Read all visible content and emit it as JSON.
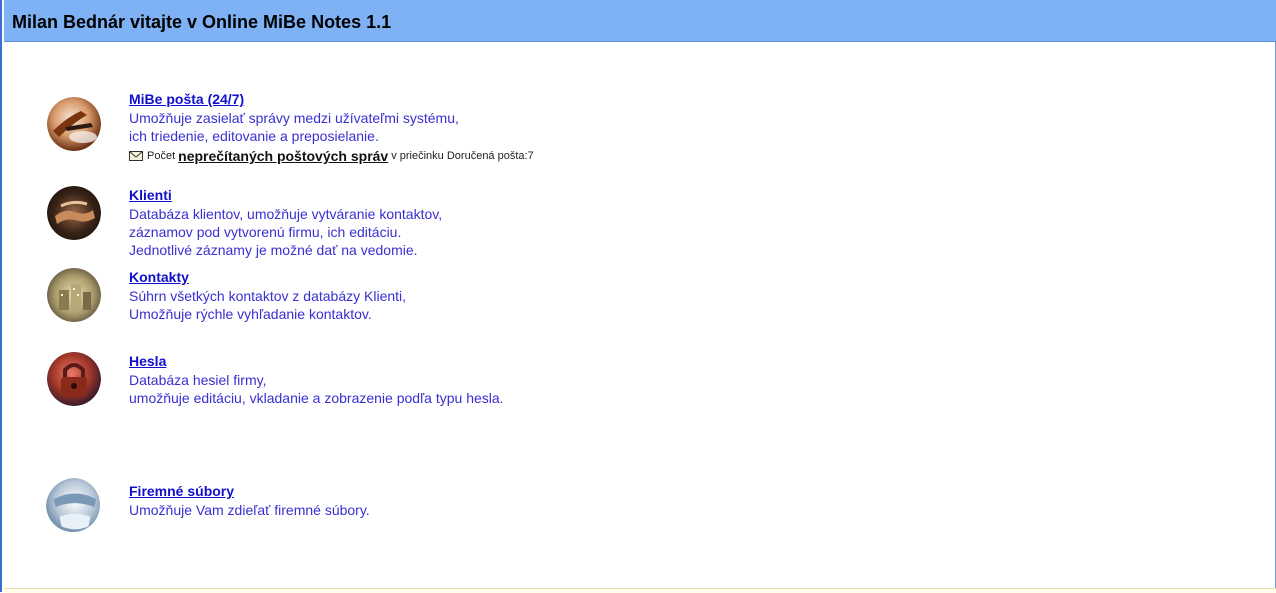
{
  "header": {
    "title": "Milan Bednár vitajte v Online MiBe Notes 1.1",
    "background": "#7fb2f5"
  },
  "modules": [
    {
      "icon": "mail-writing-icon",
      "title": "MiBe pošta (24/7)",
      "lines": [
        "Umožňuje zasielať správy medzi užívateľmi systému,",
        "ich triedenie, editovanie a preposielanie."
      ]
    },
    {
      "icon": "handshake-icon",
      "title": "Klienti",
      "lines": [
        "Databáza klientov, umožňuje vytváranie kontaktov,",
        "záznamov pod vytvorenú firmu, ich editáciu.",
        "Jednotlivé záznamy je možné dať na vedomie."
      ]
    },
    {
      "icon": "city-buildings-icon",
      "title": "Kontakty",
      "lines": [
        "Súhrn všetkých kontaktov z databázy Klienti,",
        "Umožňuje rýchle vyhľadanie kontaktov."
      ]
    },
    {
      "icon": "padlock-icon",
      "title": "Hesla",
      "lines": [
        "Databáza hesiel firmy,",
        "umožňuje editáciu, vkladanie a zobrazenie podľa typu hesla."
      ]
    },
    {
      "icon": "shared-files-icon",
      "title": "Firemné súbory",
      "lines": [
        "Umožňuje Vam zdieľať firemné súbory."
      ]
    }
  ],
  "mail_info": {
    "icon": "envelope-icon",
    "prefix": "Počet",
    "link": "neprečítaných poštových správ",
    "suffix": "v priečinku Doručená pošta:7"
  },
  "colors": {
    "link": "#1010cc",
    "description": "#3a2fd0",
    "frame_border": "#3a6fcf"
  }
}
